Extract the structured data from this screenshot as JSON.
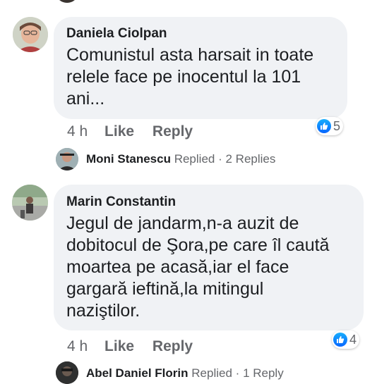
{
  "comments": [
    {
      "author": "Daniela Ciolpan",
      "lines": [
        "Comunistul asta harsait in toate",
        "relele face pe inocentul la 101",
        "ani..."
      ],
      "time": "4 h",
      "like_label": "Like",
      "reply_label": "Reply",
      "reaction_count": "5",
      "replies": {
        "name": "Moni Stanescu",
        "action": "Replied",
        "separator": "·",
        "count_text": "2 Replies"
      }
    },
    {
      "author": "Marin Constantin",
      "lines": [
        "Jegul de jandarm,n-a auzit de",
        "dobitocul de Şora,pe care îl caută",
        "moartea pe acasă,iar el face",
        "gargară ieftină,la mitingul",
        "naziştilor."
      ],
      "time": "4 h",
      "like_label": "Like",
      "reply_label": "Reply",
      "reaction_count": "4",
      "replies": {
        "name": "Abel Daniel Florin",
        "action": "Replied",
        "separator": "·",
        "count_text": "1 Reply"
      }
    }
  ],
  "colors": {
    "bubble": "#f0f2f5",
    "meta": "#65676b",
    "like_blue": "#0866ff"
  }
}
